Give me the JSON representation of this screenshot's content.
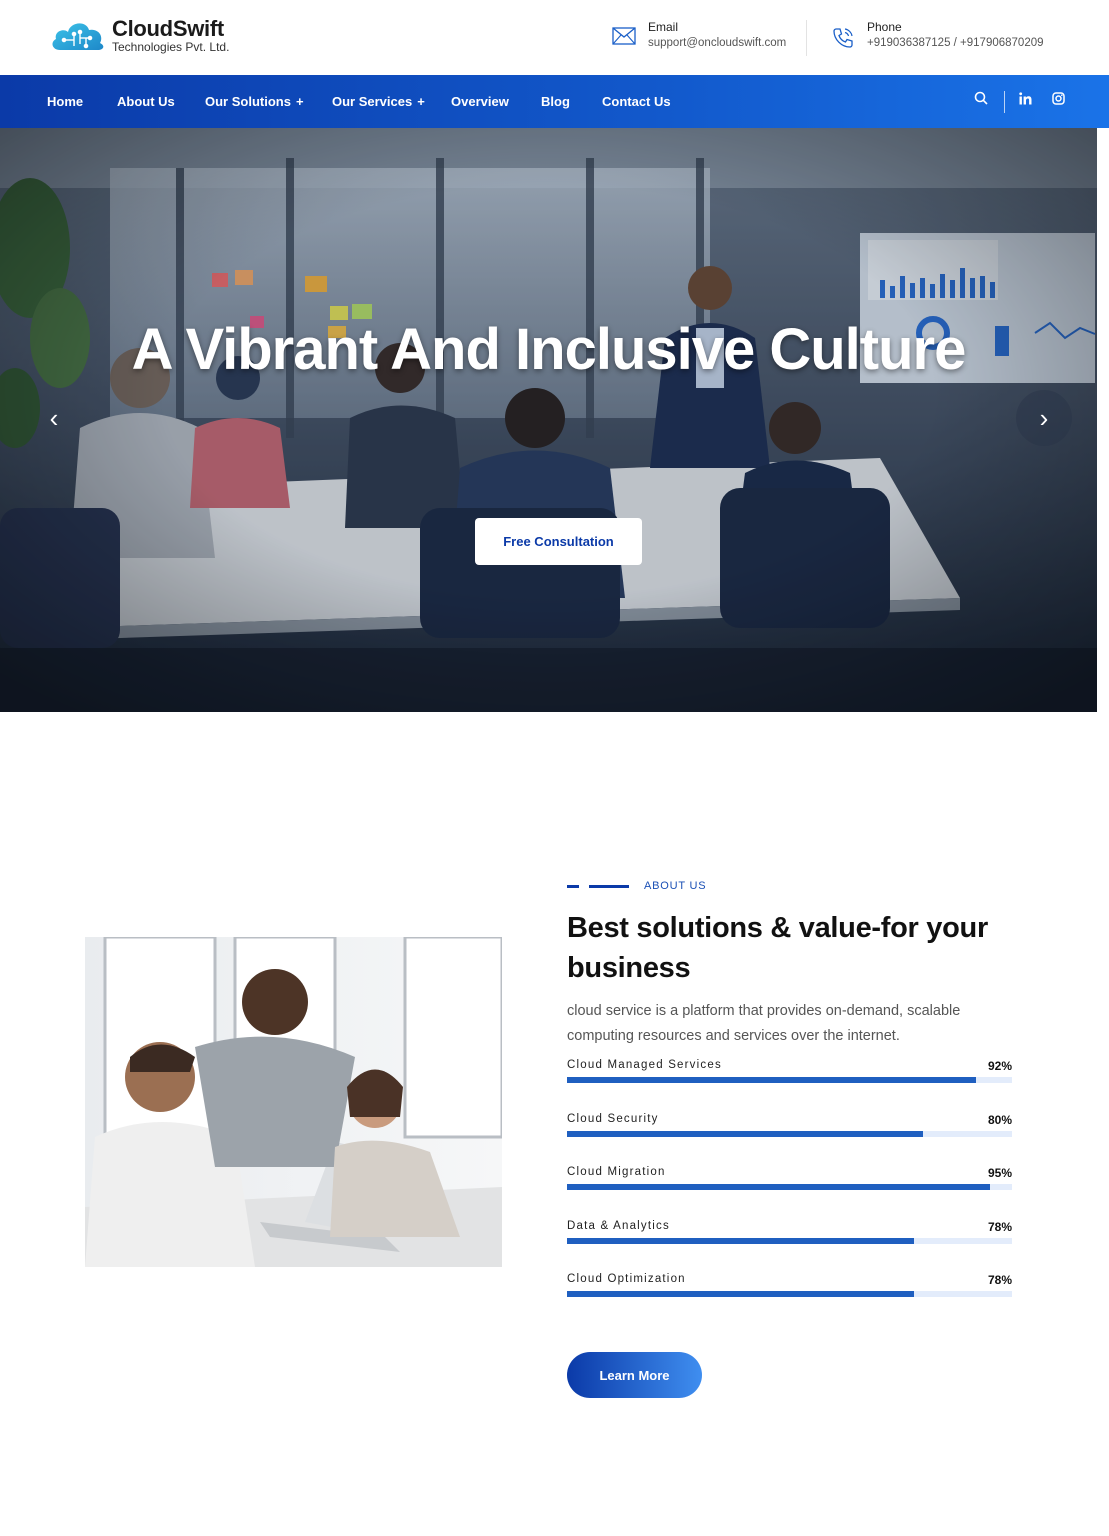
{
  "brand": {
    "name": "CloudSwift",
    "subtitle": "Technologies Pvt. Ltd."
  },
  "header": {
    "email_label": "Email",
    "email_value": "support@oncloudswift.com",
    "phone_label": "Phone",
    "phone_value": "+919036387125 / +917906870209"
  },
  "nav": {
    "items": [
      {
        "label": "Home"
      },
      {
        "label": "About Us"
      },
      {
        "label": "Our Solutions",
        "plus": "+"
      },
      {
        "label": "Our Services",
        "plus": "+"
      },
      {
        "label": "Overview"
      },
      {
        "label": "Blog"
      },
      {
        "label": "Contact Us"
      }
    ],
    "icons": [
      "search-icon",
      "linkedin-icon",
      "instagram-icon"
    ]
  },
  "hero": {
    "title": "A Vibrant And Inclusive Culture",
    "button": "Free Consultation",
    "prev": "‹",
    "next": "›"
  },
  "about": {
    "eyebrow": "ABOUT US",
    "title": "Best solutions & value-for your business",
    "description": "cloud service is a platform that provides on-demand, scalable computing resources and services over the internet.",
    "skills": [
      {
        "name": "Cloud Managed Services",
        "percent_label": "92%",
        "value": 92
      },
      {
        "name": "Cloud Security",
        "percent_label": "80%",
        "value": 80
      },
      {
        "name": "Cloud Migration",
        "percent_label": "95%",
        "value": 95
      },
      {
        "name": "Data & Analytics",
        "percent_label": "78%",
        "value": 78
      },
      {
        "name": "Cloud Optimization",
        "percent_label": "78%",
        "value": 78
      }
    ],
    "button": "Learn More"
  },
  "colors": {
    "primary": "#0b3aa8",
    "accent": "#1a73e8",
    "progress_fill": "#1f5fc0",
    "progress_track": "#e3ecfb"
  }
}
